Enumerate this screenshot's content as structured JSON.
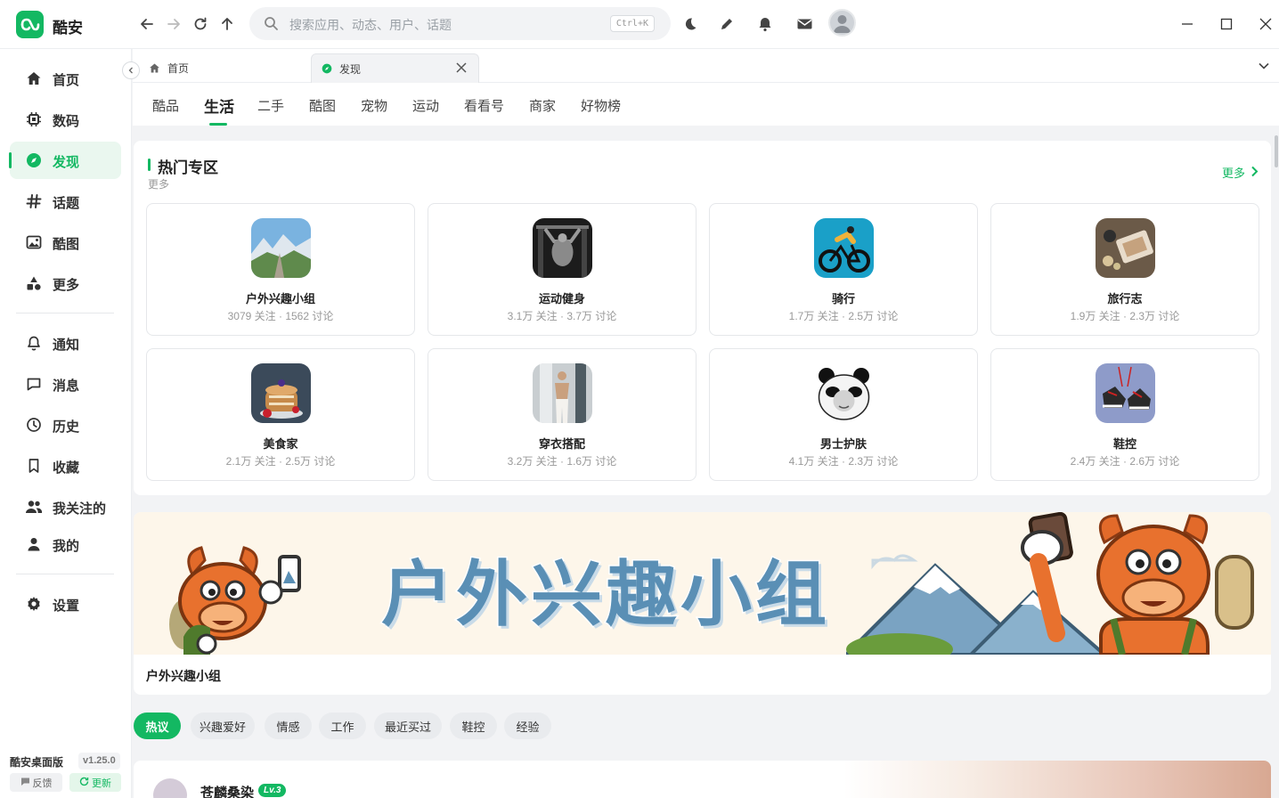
{
  "app": {
    "name": "酷安"
  },
  "search": {
    "placeholder": "搜索应用、动态、用户、话题",
    "shortcut": "Ctrl+K"
  },
  "sidebar": {
    "items": [
      {
        "label": "首页",
        "icon": "home-icon"
      },
      {
        "label": "数码",
        "icon": "chip-icon"
      },
      {
        "label": "发现",
        "icon": "compass-icon",
        "active": true
      },
      {
        "label": "话题",
        "icon": "hash-icon"
      },
      {
        "label": "酷图",
        "icon": "image-icon"
      },
      {
        "label": "更多",
        "icon": "shapes-icon"
      },
      {
        "label": "通知",
        "icon": "bell-icon"
      },
      {
        "label": "消息",
        "icon": "chat-icon"
      },
      {
        "label": "历史",
        "icon": "clock-icon"
      },
      {
        "label": "收藏",
        "icon": "bookmark-icon"
      },
      {
        "label": "我关注的",
        "icon": "people-icon"
      },
      {
        "label": "我的",
        "icon": "person-icon"
      },
      {
        "label": "设置",
        "icon": "gear-icon"
      }
    ],
    "version_label": "酷安桌面版",
    "version": "v1.25.0",
    "feedback": "反馈",
    "update": "更新"
  },
  "tabs": [
    {
      "label": "首页",
      "icon": "home-icon"
    },
    {
      "label": "发现",
      "icon": "compass-icon",
      "active": true
    }
  ],
  "categories": [
    "酷品",
    "生活",
    "二手",
    "酷图",
    "宠物",
    "运动",
    "看看号",
    "商家",
    "好物榜"
  ],
  "active_category": "生活",
  "hot": {
    "title": "热门专区",
    "subtitle": "更多",
    "more": "更多",
    "groups": [
      {
        "name": "户外兴趣小组",
        "stats": "3079 关注 · 1562 讨论"
      },
      {
        "name": "运动健身",
        "stats": "3.1万 关注 · 3.7万 讨论"
      },
      {
        "name": "骑行",
        "stats": "1.7万 关注 · 2.5万 讨论"
      },
      {
        "name": "旅行志",
        "stats": "1.9万 关注 · 2.3万 讨论"
      },
      {
        "name": "美食家",
        "stats": "2.1万 关注 · 2.5万 讨论"
      },
      {
        "name": "穿衣搭配",
        "stats": "3.2万 关注 · 1.6万 讨论"
      },
      {
        "name": "男士护肤",
        "stats": "4.1万 关注 · 2.3万 讨论"
      },
      {
        "name": "鞋控",
        "stats": "2.4万 关注 · 2.6万 讨论"
      }
    ]
  },
  "banner": {
    "text": "户外兴趣小组",
    "caption": "户外兴趣小组"
  },
  "chips": [
    "热议",
    "兴趣爱好",
    "情感",
    "工作",
    "最近买过",
    "鞋控",
    "经验"
  ],
  "feed": {
    "user": "苍麟桑染",
    "level": "Lv.3"
  },
  "colors": {
    "brand": "#13b862",
    "banner_text": "#5a8fb5"
  }
}
